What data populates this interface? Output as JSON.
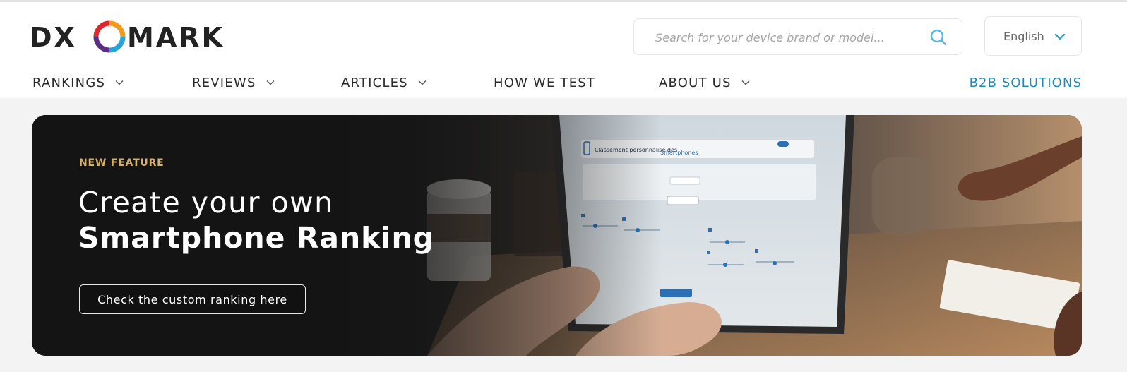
{
  "brand": {
    "logo_text_left": "DX",
    "logo_text_right": "MARK"
  },
  "search": {
    "placeholder": "Search for your device brand or model..."
  },
  "language": {
    "selected": "English"
  },
  "nav": {
    "items": [
      {
        "label": "RANKINGS"
      },
      {
        "label": "REVIEWS"
      },
      {
        "label": "ARTICLES"
      },
      {
        "label": "HOW WE TEST"
      },
      {
        "label": "ABOUT US"
      }
    ],
    "b2b_label": "B2B SOLUTIONS"
  },
  "banner": {
    "kicker": "NEW FEATURE",
    "headline_line1": "Create your own",
    "headline_line2": "Smartphone Ranking",
    "cta_label": "Check the custom ranking here"
  },
  "colors": {
    "accent_blue": "#1a8bbf",
    "kicker_gold": "#d4b06a",
    "logo_dark": "#222222"
  },
  "icons": {
    "search": "search-icon",
    "language_chevron": "chevron-down-icon",
    "nav_chevron": "chevron-down-icon"
  }
}
